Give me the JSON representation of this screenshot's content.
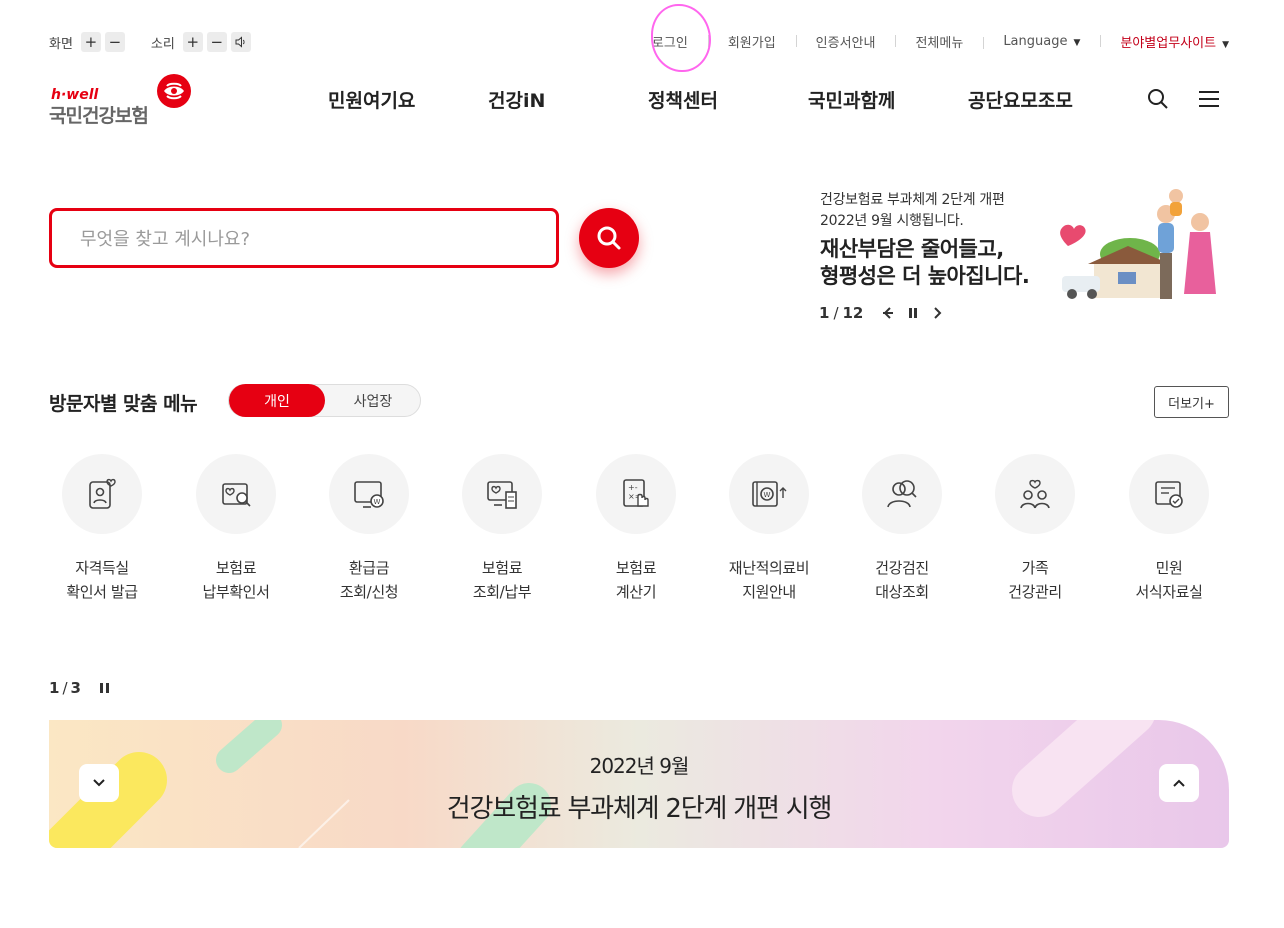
{
  "utility": {
    "screen_label": "화면",
    "sound_label": "소리",
    "plus": "+",
    "minus": "−",
    "links": [
      "로그인",
      "회원가입",
      "인증서안내",
      "전체메뉴"
    ],
    "language": "Language",
    "affiliate": "분야별업무사이트"
  },
  "logo": {
    "tagline": "h·well",
    "name": "국민건강보험"
  },
  "gnb": [
    "민원여기요",
    "건강iN",
    "정책센터",
    "국민과함께",
    "공단요모조모"
  ],
  "search": {
    "placeholder": "무엇을 찾고 계시나요?"
  },
  "banner": {
    "line1": "건강보험료 부과체계 2단계 개편",
    "line2": "2022년 9월 시행됩니다.",
    "headline1": "재산부담은 줄어들고,",
    "headline2": "형평성은 더 높아집니다.",
    "current": "1",
    "separator": "/",
    "total": "12"
  },
  "visitor_menu": {
    "title": "방문자별 맞춤 메뉴",
    "tab_personal": "개인",
    "tab_business": "사업장",
    "more": "더보기+",
    "items": [
      {
        "l1": "자격득실",
        "l2": "확인서 발급",
        "icon": "id-card-heart-icon"
      },
      {
        "l1": "보험료",
        "l2": "납부확인서",
        "icon": "document-search-icon"
      },
      {
        "l1": "환급금",
        "l2": "조회/신청",
        "icon": "monitor-won-icon"
      },
      {
        "l1": "보험료",
        "l2": "조회/납부",
        "icon": "monitor-receipt-icon"
      },
      {
        "l1": "보험료",
        "l2": "계산기",
        "icon": "calculator-hand-icon"
      },
      {
        "l1": "재난적의료비",
        "l2": "지원안내",
        "icon": "wallet-won-up-icon"
      },
      {
        "l1": "건강검진",
        "l2": "대상조회",
        "icon": "person-search-icon"
      },
      {
        "l1": "가족",
        "l2": "건강관리",
        "icon": "family-heart-icon"
      },
      {
        "l1": "민원",
        "l2": "서식자료실",
        "icon": "form-check-icon"
      }
    ]
  },
  "promo": {
    "current": "1",
    "separator": "/",
    "total": "3",
    "date": "2022년 9월",
    "title": "건강보험료 부과체계 2단계 개편 시행"
  },
  "colors": {
    "accent": "#e60012",
    "annotation": "#ff66ee"
  }
}
